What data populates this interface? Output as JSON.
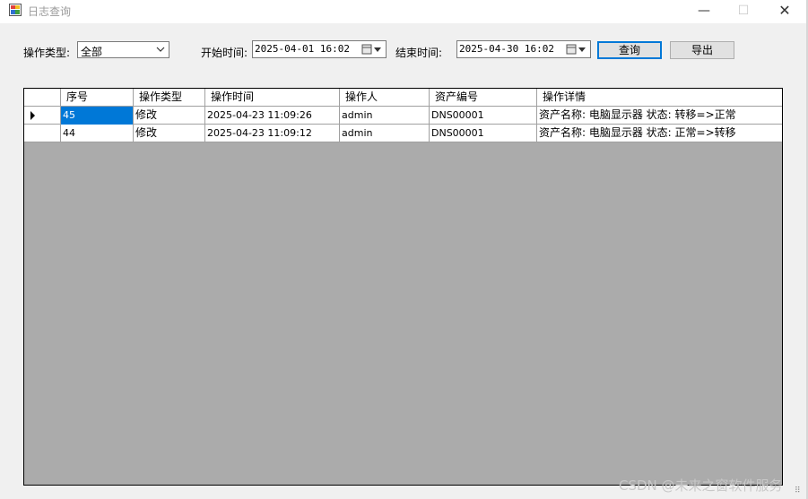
{
  "window": {
    "title": "日志查询",
    "min_glyph": "—",
    "max_glyph": "☐",
    "close_glyph": "✕",
    "icon": "app-window-icon"
  },
  "filters": {
    "op_type_label": "操作类型:",
    "op_type_value": "全部",
    "start_label": "开始时间:",
    "start_value": "2025-04-01 16:02",
    "end_label": "结束时间:",
    "end_value": "2025-04-30 16:02"
  },
  "buttons": {
    "query": "查询",
    "export": "导出"
  },
  "grid": {
    "columns": [
      "序号",
      "操作类型",
      "操作时间",
      "操作人",
      "资产编号",
      "操作详情"
    ],
    "rows": [
      {
        "id": "45",
        "type": "修改",
        "time": "2025-04-23 11:09:26",
        "user": "admin",
        "asset": "DNS00001",
        "detail": "资产名称: 电脑显示器  状态: 转移=>正常",
        "selected": true
      },
      {
        "id": "44",
        "type": "修改",
        "time": "2025-04-23 11:09:12",
        "user": "admin",
        "asset": "DNS00001",
        "detail": "资产名称: 电脑显示器  状态: 正常=>转移",
        "selected": false
      }
    ]
  },
  "watermark": "CSDN @未来之窗软件服务",
  "colors": {
    "selection": "#0078d7",
    "grid_background": "#ababab",
    "window_background": "#f0f0f0"
  }
}
